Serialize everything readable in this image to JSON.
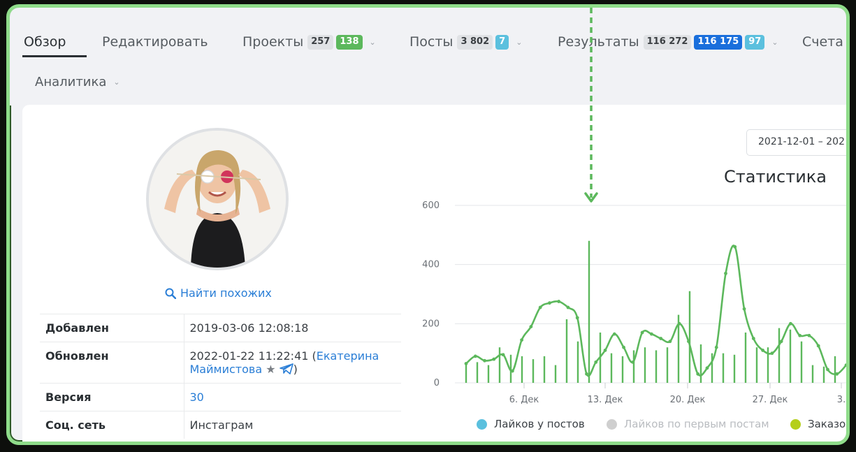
{
  "tabs": {
    "overview": "Обзор",
    "edit": "Редактировать",
    "projects": {
      "label": "Проекты",
      "count": "257",
      "active": "138"
    },
    "posts": {
      "label": "Посты",
      "count": "3 802",
      "new": "7"
    },
    "results": {
      "label": "Результаты",
      "count": "116 272",
      "primary": "116 175",
      "secondary": "97"
    },
    "accounts": "Счета",
    "analytics": "Аналитика"
  },
  "profile": {
    "find_similar": "Найти похожих",
    "rows": [
      {
        "key": "Добавлен",
        "value": "2019-03-06 12:08:18"
      },
      {
        "key": "Обновлен",
        "value": "2022-01-22 11:22:41 (",
        "user": "Екатерина Маймистова",
        "suffix": ")"
      },
      {
        "key": "Версия",
        "value": "30"
      },
      {
        "key": "Соц. сеть",
        "value": "Инстаграм"
      }
    ]
  },
  "stats": {
    "date_range": "2021-12-01 – 202",
    "title": "Статистика"
  },
  "chart_data": {
    "type": "line",
    "ylim": [
      0,
      600
    ],
    "yticks": [
      "600",
      "400",
      "200",
      "0"
    ],
    "xticks": [
      "6. Дек",
      "13. Дек",
      "20. Дек",
      "27. Дек",
      "3."
    ],
    "series": [
      {
        "name": "Лайков у постов",
        "color": "#5bc0de"
      },
      {
        "name": "Лайков по первым постам",
        "color": "#cfcfcf"
      },
      {
        "name": "Заказо",
        "color": "#b5cf1b"
      }
    ],
    "line": [
      65,
      90,
      75,
      80,
      95,
      40,
      145,
      190,
      255,
      270,
      275,
      255,
      220,
      30,
      70,
      110,
      165,
      120,
      70,
      170,
      165,
      150,
      140,
      200,
      140,
      30,
      50,
      120,
      370,
      460,
      250,
      150,
      110,
      100,
      140,
      200,
      160,
      160,
      125,
      45,
      30,
      60
    ],
    "bars": [
      70,
      70,
      60,
      120,
      95,
      90,
      80,
      90,
      60,
      215,
      140,
      480,
      170,
      100,
      90,
      110,
      120,
      110,
      120,
      230,
      310,
      130,
      100,
      100,
      95,
      170,
      120,
      120,
      185,
      180,
      140,
      60,
      55,
      90
    ]
  },
  "colors": {
    "accent": "#2a7ed6",
    "line": "#5cb85c",
    "frame": "#8fdc8a"
  }
}
